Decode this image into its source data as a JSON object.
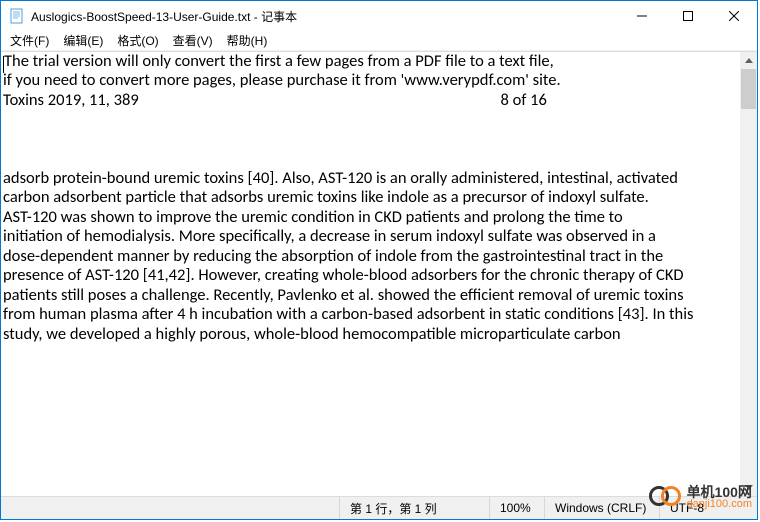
{
  "titlebar": {
    "icon_name": "notepad-icon",
    "title": "Auslogics-BoostSpeed-13-User-Guide.txt - 记事本"
  },
  "menu": {
    "file": "文件(F)",
    "edit": "编辑(E)",
    "format": "格式(O)",
    "view": "查看(V)",
    "help": "帮助(H)"
  },
  "content": "The trial version will only convert the first a few pages from a PDF file to a text file,\nif you need to convert more pages, please purchase it from 'www.verypdf.com' site.\nToxins 2019, 11, 389                                                                                                 8 of 16\n\n\n\nadsorb protein-bound uremic toxins [40]. Also, AST-120 is an orally administered, intestinal, activated\ncarbon adsorbent particle that adsorbs uremic toxins like indole as a precursor of indoxyl sulfate.\nAST-120 was shown to improve the uremic condition in CKD patients and prolong the time to\ninitiation of hemodialysis. More specifically, a decrease in serum indoxyl sulfate was observed in a\ndose-dependent manner by reducing the absorption of indole from the gastrointestinal tract in the\npresence of AST-120 [41,42]. However, creating whole-blood adsorbers for the chronic therapy of CKD\npatients still poses a challenge. Recently, Pavlenko et al. showed the efficient removal of uremic toxins\nfrom human plasma after 4 h incubation with a carbon-based adsorbent in static conditions [43]. In this\nstudy, we developed a highly porous, whole-blood hemocompatible microparticulate carbon",
  "status": {
    "position": "第 1 行，第 1 列",
    "zoom": "100%",
    "line_ending": "Windows (CRLF)",
    "encoding": "UTF-8"
  },
  "watermark": {
    "cn": "单机100网",
    "en": "danji100.com"
  }
}
